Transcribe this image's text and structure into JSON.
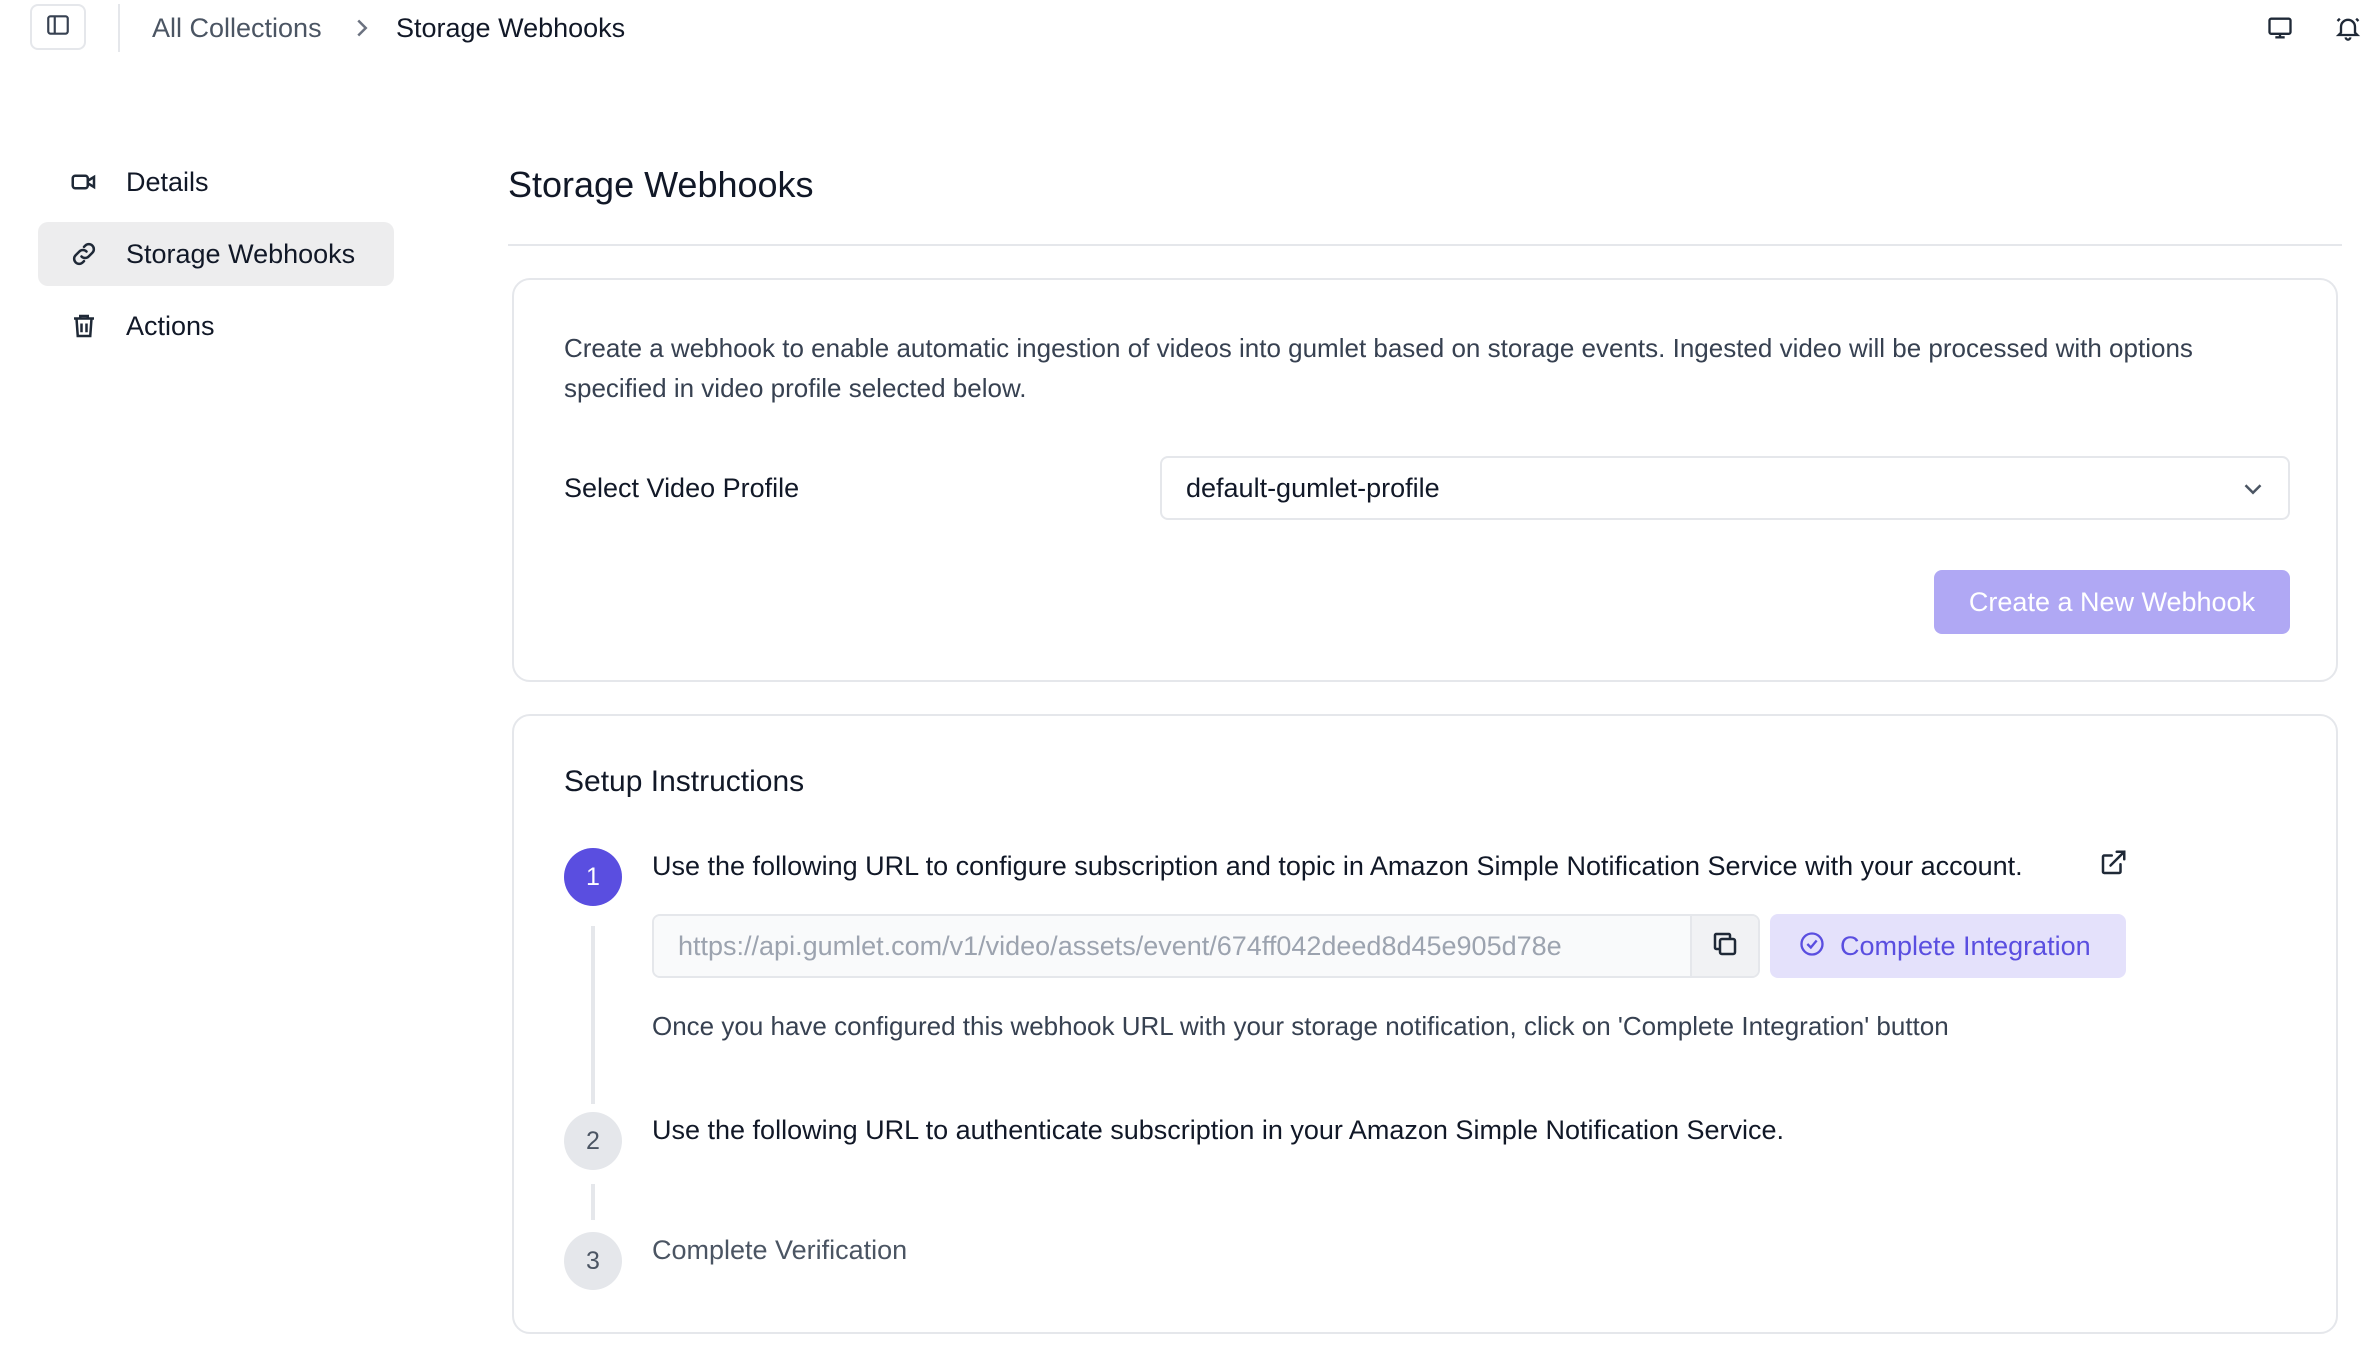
{
  "breadcrumb": {
    "parent": "All Collections",
    "current": "Storage Webhooks"
  },
  "header_icons": [
    "sidebar-toggle-icon",
    "chevron-right-icon",
    "monitor-icon",
    "bell-icon"
  ],
  "sidebar": {
    "items": [
      {
        "label": "Details",
        "icon": "video-camera-icon",
        "active": false
      },
      {
        "label": "Storage Webhooks",
        "icon": "link-icon",
        "active": true
      },
      {
        "label": "Actions",
        "icon": "trash-icon",
        "active": false
      }
    ]
  },
  "page": {
    "title": "Storage Webhooks"
  },
  "webhook_card": {
    "description": "Create a webhook to enable automatic ingestion of videos into gumlet based on storage events. Ingested video will be processed with options specified in video profile selected below.",
    "profile_label": "Select Video Profile",
    "profile_value": "default-gumlet-profile",
    "create_button": "Create a New Webhook"
  },
  "setup": {
    "title": "Setup Instructions",
    "steps": [
      {
        "number": "1",
        "text": "Use the following URL to configure subscription and topic in Amazon Simple Notification Service with your account."
      },
      {
        "number": "2",
        "text": "Use the following URL to authenticate subscription in your Amazon Simple Notification Service."
      },
      {
        "number": "3",
        "text": "Complete Verification"
      }
    ],
    "webhook_url": "https://api.gumlet.com/v1/video/assets/event/674ff042deed8d45e905d78e",
    "complete_button": "Complete Integration",
    "hint": "Once you have configured this webhook URL with your storage notification, click on 'Complete Integration' button"
  },
  "colors": {
    "accent": "#5a4ee0",
    "accent_disabled": "#b0a8f4",
    "accent_soft": "#e4e1fb",
    "border": "#e5e7eb",
    "active_nav_bg": "#ededee"
  }
}
